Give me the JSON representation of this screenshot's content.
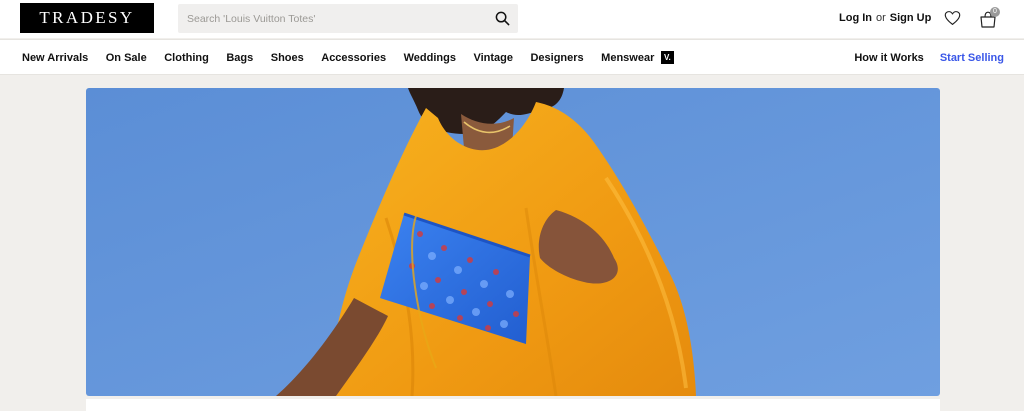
{
  "header": {
    "logo_text": "TRADESY",
    "search": {
      "placeholder": "Search 'Louis Vuitton Totes'",
      "icon": "search-icon"
    },
    "auth": {
      "login_label": "Log In",
      "or_text": "or",
      "signup_label": "Sign Up"
    },
    "wishlist_icon": "heart-icon",
    "cart": {
      "icon": "shopping-bag-icon",
      "count": "0"
    }
  },
  "nav": {
    "items": [
      {
        "label": "New Arrivals"
      },
      {
        "label": "On Sale"
      },
      {
        "label": "Clothing"
      },
      {
        "label": "Bags"
      },
      {
        "label": "Shoes"
      },
      {
        "label": "Accessories"
      },
      {
        "label": "Weddings"
      },
      {
        "label": "Vintage"
      },
      {
        "label": "Designers"
      },
      {
        "label": "Menswear"
      }
    ],
    "vw_badge": "V.",
    "how_it_works": "How it Works",
    "start_selling": "Start Selling",
    "accent_color": "#3a57e8"
  },
  "hero": {
    "sky_color": "#5d90d6",
    "dress_color": "#f3a417",
    "bag_color": "#2f73e6"
  }
}
